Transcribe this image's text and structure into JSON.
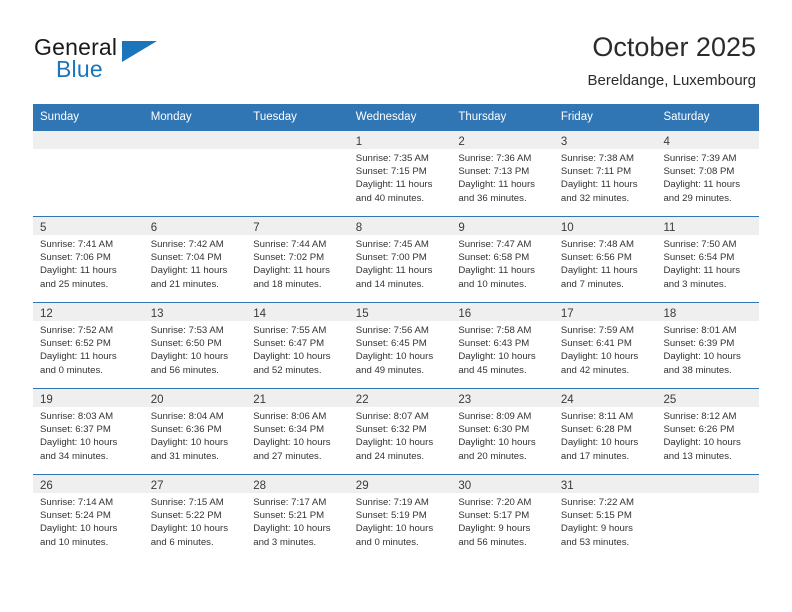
{
  "brand": {
    "name_part1": "General",
    "name_part2": "Blue",
    "logo_icon": "triangle-logo-icon",
    "accent_color": "#1b75bb"
  },
  "header": {
    "title": "October 2025",
    "subtitle": "Bereldange, Luxembourg"
  },
  "theme": {
    "header_row_bg": "#3075b4",
    "daynum_bar_bg": "#efefef",
    "cell_bg": "#ffffff",
    "text_color": "#333333"
  },
  "weekday_headers": [
    "Sunday",
    "Monday",
    "Tuesday",
    "Wednesday",
    "Thursday",
    "Friday",
    "Saturday"
  ],
  "weeks": [
    [
      {
        "day": "",
        "empty": true,
        "sunrise": "",
        "sunset": "",
        "daylight_1": "",
        "daylight_2": ""
      },
      {
        "day": "",
        "empty": true,
        "sunrise": "",
        "sunset": "",
        "daylight_1": "",
        "daylight_2": ""
      },
      {
        "day": "",
        "empty": true,
        "sunrise": "",
        "sunset": "",
        "daylight_1": "",
        "daylight_2": ""
      },
      {
        "day": "1",
        "empty": false,
        "sunrise": "Sunrise: 7:35 AM",
        "sunset": "Sunset: 7:15 PM",
        "daylight_1": "Daylight: 11 hours",
        "daylight_2": "and 40 minutes."
      },
      {
        "day": "2",
        "empty": false,
        "sunrise": "Sunrise: 7:36 AM",
        "sunset": "Sunset: 7:13 PM",
        "daylight_1": "Daylight: 11 hours",
        "daylight_2": "and 36 minutes."
      },
      {
        "day": "3",
        "empty": false,
        "sunrise": "Sunrise: 7:38 AM",
        "sunset": "Sunset: 7:11 PM",
        "daylight_1": "Daylight: 11 hours",
        "daylight_2": "and 32 minutes."
      },
      {
        "day": "4",
        "empty": false,
        "sunrise": "Sunrise: 7:39 AM",
        "sunset": "Sunset: 7:08 PM",
        "daylight_1": "Daylight: 11 hours",
        "daylight_2": "and 29 minutes."
      }
    ],
    [
      {
        "day": "5",
        "empty": false,
        "sunrise": "Sunrise: 7:41 AM",
        "sunset": "Sunset: 7:06 PM",
        "daylight_1": "Daylight: 11 hours",
        "daylight_2": "and 25 minutes."
      },
      {
        "day": "6",
        "empty": false,
        "sunrise": "Sunrise: 7:42 AM",
        "sunset": "Sunset: 7:04 PM",
        "daylight_1": "Daylight: 11 hours",
        "daylight_2": "and 21 minutes."
      },
      {
        "day": "7",
        "empty": false,
        "sunrise": "Sunrise: 7:44 AM",
        "sunset": "Sunset: 7:02 PM",
        "daylight_1": "Daylight: 11 hours",
        "daylight_2": "and 18 minutes."
      },
      {
        "day": "8",
        "empty": false,
        "sunrise": "Sunrise: 7:45 AM",
        "sunset": "Sunset: 7:00 PM",
        "daylight_1": "Daylight: 11 hours",
        "daylight_2": "and 14 minutes."
      },
      {
        "day": "9",
        "empty": false,
        "sunrise": "Sunrise: 7:47 AM",
        "sunset": "Sunset: 6:58 PM",
        "daylight_1": "Daylight: 11 hours",
        "daylight_2": "and 10 minutes."
      },
      {
        "day": "10",
        "empty": false,
        "sunrise": "Sunrise: 7:48 AM",
        "sunset": "Sunset: 6:56 PM",
        "daylight_1": "Daylight: 11 hours",
        "daylight_2": "and 7 minutes."
      },
      {
        "day": "11",
        "empty": false,
        "sunrise": "Sunrise: 7:50 AM",
        "sunset": "Sunset: 6:54 PM",
        "daylight_1": "Daylight: 11 hours",
        "daylight_2": "and 3 minutes."
      }
    ],
    [
      {
        "day": "12",
        "empty": false,
        "sunrise": "Sunrise: 7:52 AM",
        "sunset": "Sunset: 6:52 PM",
        "daylight_1": "Daylight: 11 hours",
        "daylight_2": "and 0 minutes."
      },
      {
        "day": "13",
        "empty": false,
        "sunrise": "Sunrise: 7:53 AM",
        "sunset": "Sunset: 6:50 PM",
        "daylight_1": "Daylight: 10 hours",
        "daylight_2": "and 56 minutes."
      },
      {
        "day": "14",
        "empty": false,
        "sunrise": "Sunrise: 7:55 AM",
        "sunset": "Sunset: 6:47 PM",
        "daylight_1": "Daylight: 10 hours",
        "daylight_2": "and 52 minutes."
      },
      {
        "day": "15",
        "empty": false,
        "sunrise": "Sunrise: 7:56 AM",
        "sunset": "Sunset: 6:45 PM",
        "daylight_1": "Daylight: 10 hours",
        "daylight_2": "and 49 minutes."
      },
      {
        "day": "16",
        "empty": false,
        "sunrise": "Sunrise: 7:58 AM",
        "sunset": "Sunset: 6:43 PM",
        "daylight_1": "Daylight: 10 hours",
        "daylight_2": "and 45 minutes."
      },
      {
        "day": "17",
        "empty": false,
        "sunrise": "Sunrise: 7:59 AM",
        "sunset": "Sunset: 6:41 PM",
        "daylight_1": "Daylight: 10 hours",
        "daylight_2": "and 42 minutes."
      },
      {
        "day": "18",
        "empty": false,
        "sunrise": "Sunrise: 8:01 AM",
        "sunset": "Sunset: 6:39 PM",
        "daylight_1": "Daylight: 10 hours",
        "daylight_2": "and 38 minutes."
      }
    ],
    [
      {
        "day": "19",
        "empty": false,
        "sunrise": "Sunrise: 8:03 AM",
        "sunset": "Sunset: 6:37 PM",
        "daylight_1": "Daylight: 10 hours",
        "daylight_2": "and 34 minutes."
      },
      {
        "day": "20",
        "empty": false,
        "sunrise": "Sunrise: 8:04 AM",
        "sunset": "Sunset: 6:36 PM",
        "daylight_1": "Daylight: 10 hours",
        "daylight_2": "and 31 minutes."
      },
      {
        "day": "21",
        "empty": false,
        "sunrise": "Sunrise: 8:06 AM",
        "sunset": "Sunset: 6:34 PM",
        "daylight_1": "Daylight: 10 hours",
        "daylight_2": "and 27 minutes."
      },
      {
        "day": "22",
        "empty": false,
        "sunrise": "Sunrise: 8:07 AM",
        "sunset": "Sunset: 6:32 PM",
        "daylight_1": "Daylight: 10 hours",
        "daylight_2": "and 24 minutes."
      },
      {
        "day": "23",
        "empty": false,
        "sunrise": "Sunrise: 8:09 AM",
        "sunset": "Sunset: 6:30 PM",
        "daylight_1": "Daylight: 10 hours",
        "daylight_2": "and 20 minutes."
      },
      {
        "day": "24",
        "empty": false,
        "sunrise": "Sunrise: 8:11 AM",
        "sunset": "Sunset: 6:28 PM",
        "daylight_1": "Daylight: 10 hours",
        "daylight_2": "and 17 minutes."
      },
      {
        "day": "25",
        "empty": false,
        "sunrise": "Sunrise: 8:12 AM",
        "sunset": "Sunset: 6:26 PM",
        "daylight_1": "Daylight: 10 hours",
        "daylight_2": "and 13 minutes."
      }
    ],
    [
      {
        "day": "26",
        "empty": false,
        "sunrise": "Sunrise: 7:14 AM",
        "sunset": "Sunset: 5:24 PM",
        "daylight_1": "Daylight: 10 hours",
        "daylight_2": "and 10 minutes."
      },
      {
        "day": "27",
        "empty": false,
        "sunrise": "Sunrise: 7:15 AM",
        "sunset": "Sunset: 5:22 PM",
        "daylight_1": "Daylight: 10 hours",
        "daylight_2": "and 6 minutes."
      },
      {
        "day": "28",
        "empty": false,
        "sunrise": "Sunrise: 7:17 AM",
        "sunset": "Sunset: 5:21 PM",
        "daylight_1": "Daylight: 10 hours",
        "daylight_2": "and 3 minutes."
      },
      {
        "day": "29",
        "empty": false,
        "sunrise": "Sunrise: 7:19 AM",
        "sunset": "Sunset: 5:19 PM",
        "daylight_1": "Daylight: 10 hours",
        "daylight_2": "and 0 minutes."
      },
      {
        "day": "30",
        "empty": false,
        "sunrise": "Sunrise: 7:20 AM",
        "sunset": "Sunset: 5:17 PM",
        "daylight_1": "Daylight: 9 hours",
        "daylight_2": "and 56 minutes."
      },
      {
        "day": "31",
        "empty": false,
        "sunrise": "Sunrise: 7:22 AM",
        "sunset": "Sunset: 5:15 PM",
        "daylight_1": "Daylight: 9 hours",
        "daylight_2": "and 53 minutes."
      },
      {
        "day": "",
        "empty": true,
        "sunrise": "",
        "sunset": "",
        "daylight_1": "",
        "daylight_2": ""
      }
    ]
  ]
}
